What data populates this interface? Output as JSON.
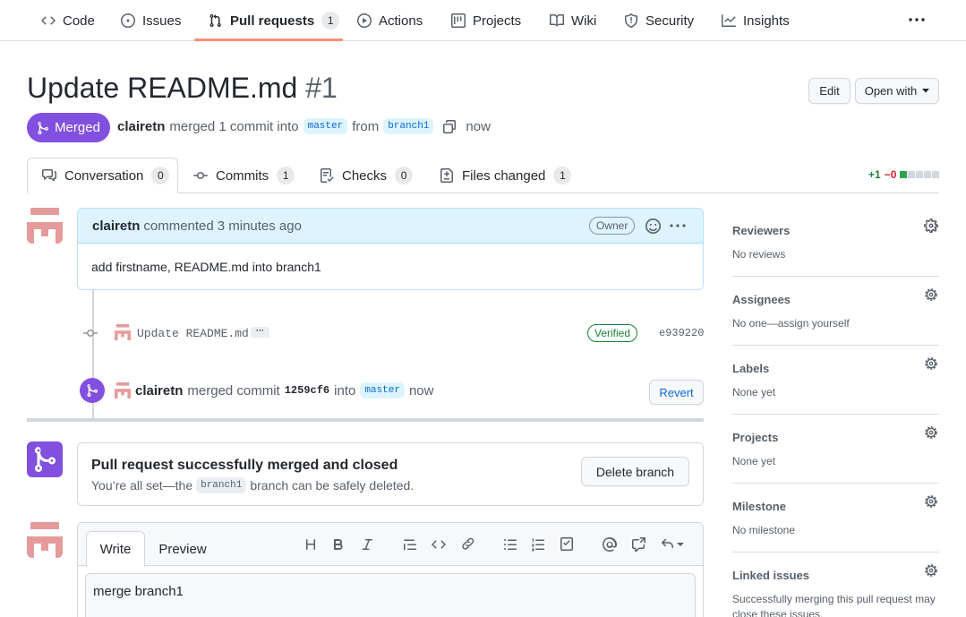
{
  "repo_nav": {
    "items": [
      {
        "label": "Code",
        "icon": "code-icon"
      },
      {
        "label": "Issues",
        "icon": "issue-icon"
      },
      {
        "label": "Pull requests",
        "icon": "git-pull-request-icon",
        "count": "1",
        "selected": true
      },
      {
        "label": "Actions",
        "icon": "play-icon"
      },
      {
        "label": "Projects",
        "icon": "project-icon"
      },
      {
        "label": "Wiki",
        "icon": "book-icon"
      },
      {
        "label": "Security",
        "icon": "shield-icon"
      },
      {
        "label": "Insights",
        "icon": "graph-icon"
      }
    ]
  },
  "pr": {
    "title": "Update README.md",
    "number": "#1",
    "status": "Merged",
    "author": "clairetn",
    "merged_text": "merged 1 commit into",
    "base_branch": "master",
    "from_text": "from",
    "head_branch": "branch1",
    "time": "now",
    "edit_label": "Edit",
    "open_with_label": "Open with"
  },
  "tabs": [
    {
      "label": "Conversation",
      "count": "0",
      "icon": "comment-discussion-icon"
    },
    {
      "label": "Commits",
      "count": "1",
      "icon": "git-commit-icon"
    },
    {
      "label": "Checks",
      "count": "0",
      "icon": "checklist-icon"
    },
    {
      "label": "Files changed",
      "count": "1",
      "icon": "file-diff-icon"
    }
  ],
  "diffstat": {
    "additions": "+1",
    "deletions": "−0",
    "blocks_green": 1,
    "blocks_total": 5
  },
  "comment": {
    "author": "clairetn",
    "action": "commented",
    "time": "3 minutes ago",
    "role": "Owner",
    "body": "add firstname, README.md into branch1"
  },
  "commit": {
    "message": "Update README.md",
    "verified": "Verified",
    "sha": "e939220"
  },
  "merge_event": {
    "author": "clairetn",
    "text": "merged commit",
    "sha": "1259cf6",
    "into": "into",
    "branch": "master",
    "time": "now",
    "revert_label": "Revert"
  },
  "merged_box": {
    "heading": "Pull request successfully merged and closed",
    "sub_pre": "You’re all set—the",
    "branch": "branch1",
    "sub_post": "branch can be safely deleted.",
    "delete_label": "Delete branch"
  },
  "composer": {
    "write_tab": "Write",
    "preview_tab": "Preview",
    "text": "merge branch1"
  },
  "sidebar": [
    {
      "title": "Reviewers",
      "value": "No reviews"
    },
    {
      "title": "Assignees",
      "value": "No one—assign yourself"
    },
    {
      "title": "Labels",
      "value": "None yet"
    },
    {
      "title": "Projects",
      "value": "None yet"
    },
    {
      "title": "Milestone",
      "value": "No milestone"
    },
    {
      "title": "Linked issues",
      "value": "Successfully merging this pull request may close these issues."
    }
  ],
  "colors": {
    "merged": "#8250df",
    "accent_underline": "#fd8c73",
    "verified": "#1a7f37",
    "link": "#0969da"
  }
}
